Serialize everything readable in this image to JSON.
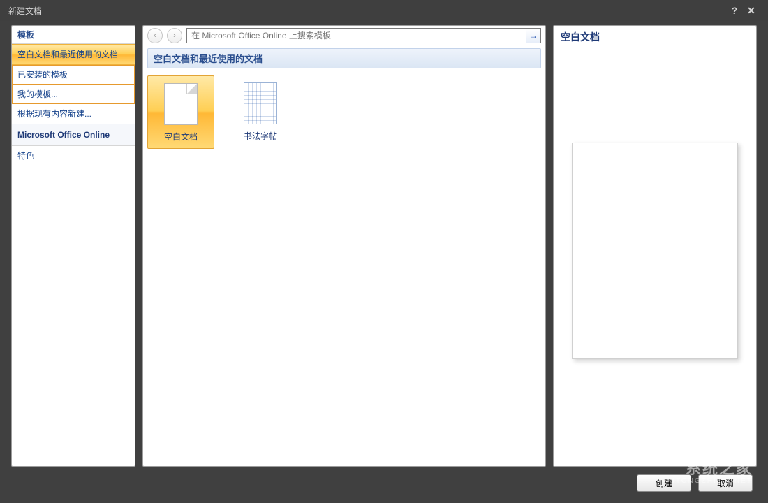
{
  "window": {
    "title": "新建文档",
    "help": "?",
    "close": "✕"
  },
  "sidebar": {
    "header": "模板",
    "items": [
      {
        "label": "空白文档和最近使用的文档",
        "selected": true
      },
      {
        "label": "已安装的模板",
        "highlight": true
      },
      {
        "label": "我的模板...",
        "highlight": true
      },
      {
        "label": "根据现有内容新建..."
      }
    ],
    "section": "Microsoft Office Online",
    "featured": "特色"
  },
  "center": {
    "nav_back": "‹",
    "nav_fwd": "›",
    "search_placeholder": "在 Microsoft Office Online 上搜索模板",
    "search_go": "→",
    "section_title": "空白文档和最近使用的文档",
    "tiles": [
      {
        "label": "空白文档",
        "icon": "doc",
        "selected": true
      },
      {
        "label": "书法字帖",
        "icon": "grid",
        "selected": false
      }
    ]
  },
  "preview": {
    "title": "空白文档"
  },
  "footer": {
    "create": "创建",
    "cancel": "取消"
  },
  "watermark": {
    "cn": "系统之家",
    "en": "XITONGZHIJIA.NET"
  }
}
